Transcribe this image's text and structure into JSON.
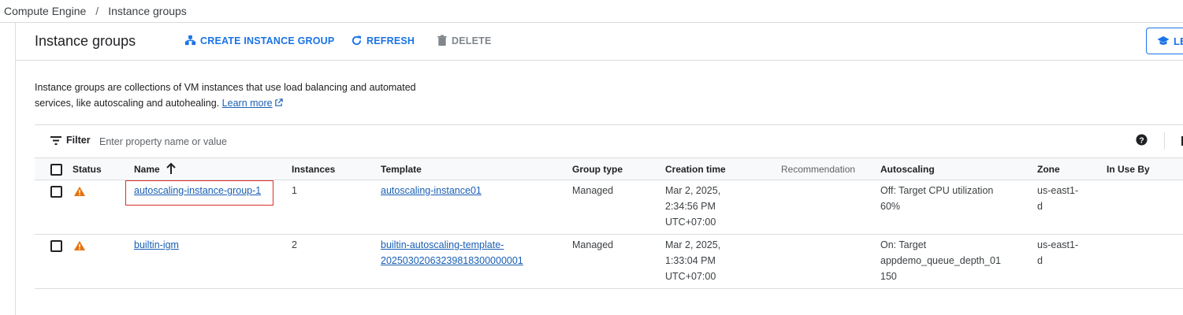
{
  "breadcrumb": {
    "items": [
      "Compute Engine",
      "Instance groups"
    ],
    "separator": "/"
  },
  "header": {
    "title": "Instance groups",
    "actions": {
      "create": "CREATE INSTANCE GROUP",
      "refresh": "REFRESH",
      "delete": "DELETE"
    },
    "learn_label": "LE"
  },
  "description": {
    "line1": "Instance groups are collections of VM instances that use load balancing and automated",
    "line2": "services, like autoscaling and autohealing.",
    "link": "Learn more"
  },
  "filter": {
    "label": "Filter",
    "placeholder": "Enter property name or value"
  },
  "table": {
    "columns": {
      "status": "Status",
      "name": "Name",
      "instances": "Instances",
      "template": "Template",
      "group_type": "Group type",
      "creation_time": "Creation time",
      "recommendation": "Recommendation",
      "autoscaling": "Autoscaling",
      "zone": "Zone",
      "in_use_by": "In Use By"
    },
    "sort": "ascending-by-name",
    "rows": [
      {
        "status": "warning",
        "name": "autoscaling-instance-group-1",
        "instances": "1",
        "template": [
          "autoscaling-instance01"
        ],
        "group_type": "Managed",
        "creation_time": [
          "Mar 2, 2025,",
          "2:34:56 PM",
          "UTC+07:00"
        ],
        "autoscaling": [
          "Off: Target CPU utilization",
          "60%"
        ],
        "zone": [
          "us-east1-",
          "d"
        ],
        "highlighted": true
      },
      {
        "status": "warning",
        "name": "builtin-igm",
        "instances": "2",
        "template": [
          "builtin-autoscaling-template-",
          "20250302063239818300000001"
        ],
        "group_type": "Managed",
        "creation_time": [
          "Mar 2, 2025,",
          "1:33:04 PM",
          "UTC+07:00"
        ],
        "autoscaling": [
          "On: Target",
          "appdemo_queue_depth_01",
          "150"
        ],
        "zone": [
          "us-east1-",
          "d"
        ],
        "highlighted": false
      }
    ]
  },
  "colors": {
    "accent": "#1a73e8",
    "link": "#1a5fb4",
    "warning": "#e8710a",
    "highlight_border": "#d93025"
  }
}
